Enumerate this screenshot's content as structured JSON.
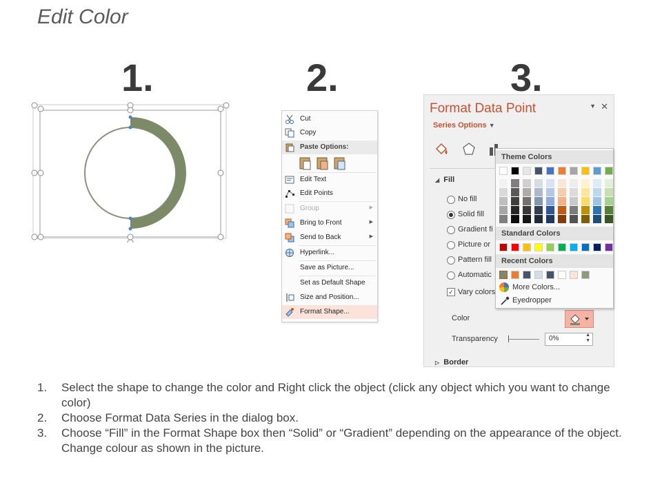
{
  "slide": {
    "title": "Edit Color",
    "step_numbers": [
      "1.",
      "2.",
      "3."
    ]
  },
  "shape": {
    "ring_color": "#7d8a68",
    "ring_outline": "#7d8a68",
    "selection_color": "#8a8a8a",
    "handle_color": "#4a86c8"
  },
  "context_menu": {
    "items": [
      {
        "label": "Cut",
        "icon": "scissors-icon"
      },
      {
        "label": "Copy",
        "icon": "copy-icon"
      },
      {
        "label": "Paste Options:",
        "icon": "paste-icon"
      },
      {
        "label": "Edit Text",
        "icon": "edit-text-icon"
      },
      {
        "label": "Edit Points",
        "icon": "edit-points-icon"
      },
      {
        "label": "Group",
        "icon": "group-icon"
      },
      {
        "label": "Bring to Front",
        "icon": "bring-front-icon"
      },
      {
        "label": "Send to Back",
        "icon": "send-back-icon"
      },
      {
        "label": "Hyperlink...",
        "icon": "hyperlink-icon"
      },
      {
        "label": "Save as Picture...",
        "icon": ""
      },
      {
        "label": "Set as Default Shape",
        "icon": ""
      },
      {
        "label": "Size and Position...",
        "icon": "size-position-icon"
      },
      {
        "label": "Format Shape...",
        "icon": "format-shape-icon"
      }
    ]
  },
  "format_panel": {
    "title": "Format Data Point",
    "series_options": "Series Options",
    "fill_section": "Fill",
    "fill_options": [
      "No fill",
      "Solid fill",
      "Gradient fi",
      "Picture or",
      "Pattern fill",
      "Automatic"
    ],
    "selected_fill": "Solid fill",
    "vary_colors": "Vary colors",
    "color_label": "Color",
    "transparency_label": "Transparency",
    "transparency_value": "0%",
    "border_section": "Border",
    "accent": "#c8512f"
  },
  "color_picker": {
    "theme_label": "Theme Colors",
    "standard_label": "Standard Colors",
    "recent_label": "Recent Colors",
    "more_colors": "More Colors...",
    "eyedropper": "Eyedropper",
    "theme_top": [
      "#ffffff",
      "#000000",
      "#e7e6e6",
      "#44546a",
      "#4472c4",
      "#ed7d31",
      "#a5a5a5",
      "#ffc000",
      "#5b9bd5",
      "#70ad47"
    ],
    "theme_shades": [
      [
        "#f2f2f2",
        "#7f7f7f",
        "#d0cece",
        "#d6dce4",
        "#dae3f3",
        "#fbe5d6",
        "#ededed",
        "#fff2cc",
        "#deebf7",
        "#e2f0d9"
      ],
      [
        "#d9d9d9",
        "#595959",
        "#aeabab",
        "#adb9ca",
        "#b4c7e7",
        "#f8cbad",
        "#dbdbdb",
        "#ffe699",
        "#bdd7ee",
        "#c5e0b4"
      ],
      [
        "#bfbfbf",
        "#3f3f3f",
        "#757171",
        "#8497b0",
        "#8faadc",
        "#f4b183",
        "#c9c9c9",
        "#ffd966",
        "#9dc3e6",
        "#a9d18e"
      ],
      [
        "#a6a6a6",
        "#262626",
        "#3a3838",
        "#333f50",
        "#2f5597",
        "#c55a11",
        "#7b7b7b",
        "#bf9000",
        "#2e75b6",
        "#548235"
      ],
      [
        "#7f7f7f",
        "#0d0d0d",
        "#171616",
        "#222a35",
        "#203864",
        "#843c0c",
        "#525252",
        "#7f6000",
        "#1f4e79",
        "#385723"
      ]
    ],
    "standard": [
      "#c00000",
      "#ff0000",
      "#ffc000",
      "#ffff00",
      "#92d050",
      "#00b050",
      "#00b0f0",
      "#0070c0",
      "#002060",
      "#7030a0"
    ],
    "recent": [
      "#7d8a68",
      "#ed7d31",
      "#44546a",
      "#d6dce4",
      "#44546a",
      "#ffffff",
      "#fbe5d6",
      "#8e9a78"
    ]
  },
  "instructions": [
    {
      "num": "1.",
      "text": "Select the shape to change the color and Right click the object (click any object which you want to change color)"
    },
    {
      "num": "2.",
      "text": "Choose Format Data Series in the dialog box."
    },
    {
      "num": "3.",
      "text": "Choose “Fill” in the Format Shape box then “Solid” or “Gradient” depending on the appearance of the object. Change colour as shown in the picture."
    }
  ]
}
